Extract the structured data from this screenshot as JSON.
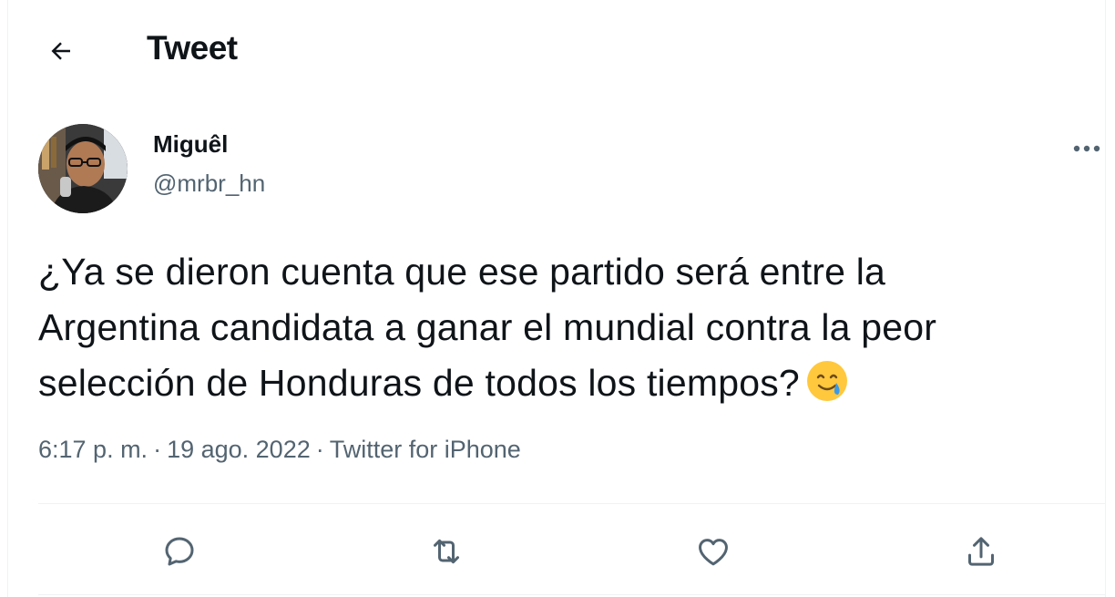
{
  "header": {
    "title": "Tweet",
    "back_icon": "arrow-left-icon"
  },
  "author": {
    "display_name": "Miguêl",
    "handle": "@mrbr_hn",
    "more_icon": "more-horizontal-icon"
  },
  "tweet": {
    "text_lines": [
      "¿Ya se dieron cuenta que ese partido será entre la",
      "Argentina candidata a ganar el mundial contra la peor",
      "selección de Honduras de todos los tiempos?"
    ],
    "emoji": "smiling-face-with-tear-emoji"
  },
  "meta": {
    "time": "6:17 p. m.",
    "separator": "·",
    "date": "19 ago. 2022",
    "source": "Twitter for iPhone"
  },
  "actions": [
    {
      "name": "reply",
      "icon": "reply-icon"
    },
    {
      "name": "retweet",
      "icon": "retweet-icon"
    },
    {
      "name": "like",
      "icon": "heart-icon"
    },
    {
      "name": "share",
      "icon": "share-icon"
    }
  ],
  "colors": {
    "primary_text": "#0f1419",
    "secondary_text": "#536471",
    "divider": "#eff3f4",
    "emoji_yellow": "#ffc83d",
    "tear_blue": "#3b9ae8"
  }
}
